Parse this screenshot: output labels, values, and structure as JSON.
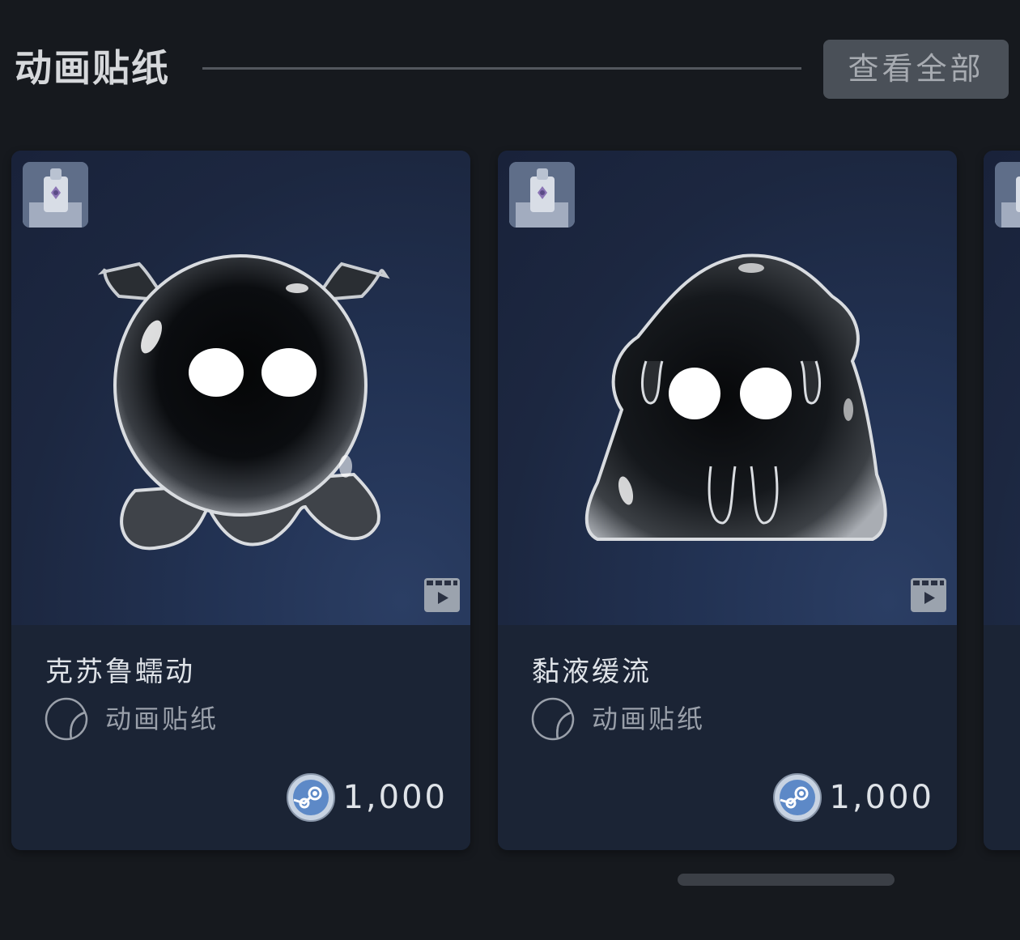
{
  "section": {
    "title": "动画贴纸",
    "view_all_label": "查看全部"
  },
  "cards": [
    {
      "name": "克苏鲁蠕动",
      "type_label": "动画贴纸",
      "price": "1,000",
      "game_thumb_icon": "game-thumbnail",
      "sticker_icon": "octopus-blob-sticker",
      "video_icon": "animated-video-icon"
    },
    {
      "name": "黏液缓流",
      "type_label": "动画贴纸",
      "price": "1,000",
      "game_thumb_icon": "game-thumbnail",
      "sticker_icon": "slime-blob-sticker",
      "video_icon": "animated-video-icon"
    }
  ],
  "colors": {
    "background": "#16191e",
    "card": "#1b2435",
    "view_all_bg": "#4a5058",
    "text_primary": "#dfe3e8",
    "text_secondary": "#9aa0aa"
  }
}
